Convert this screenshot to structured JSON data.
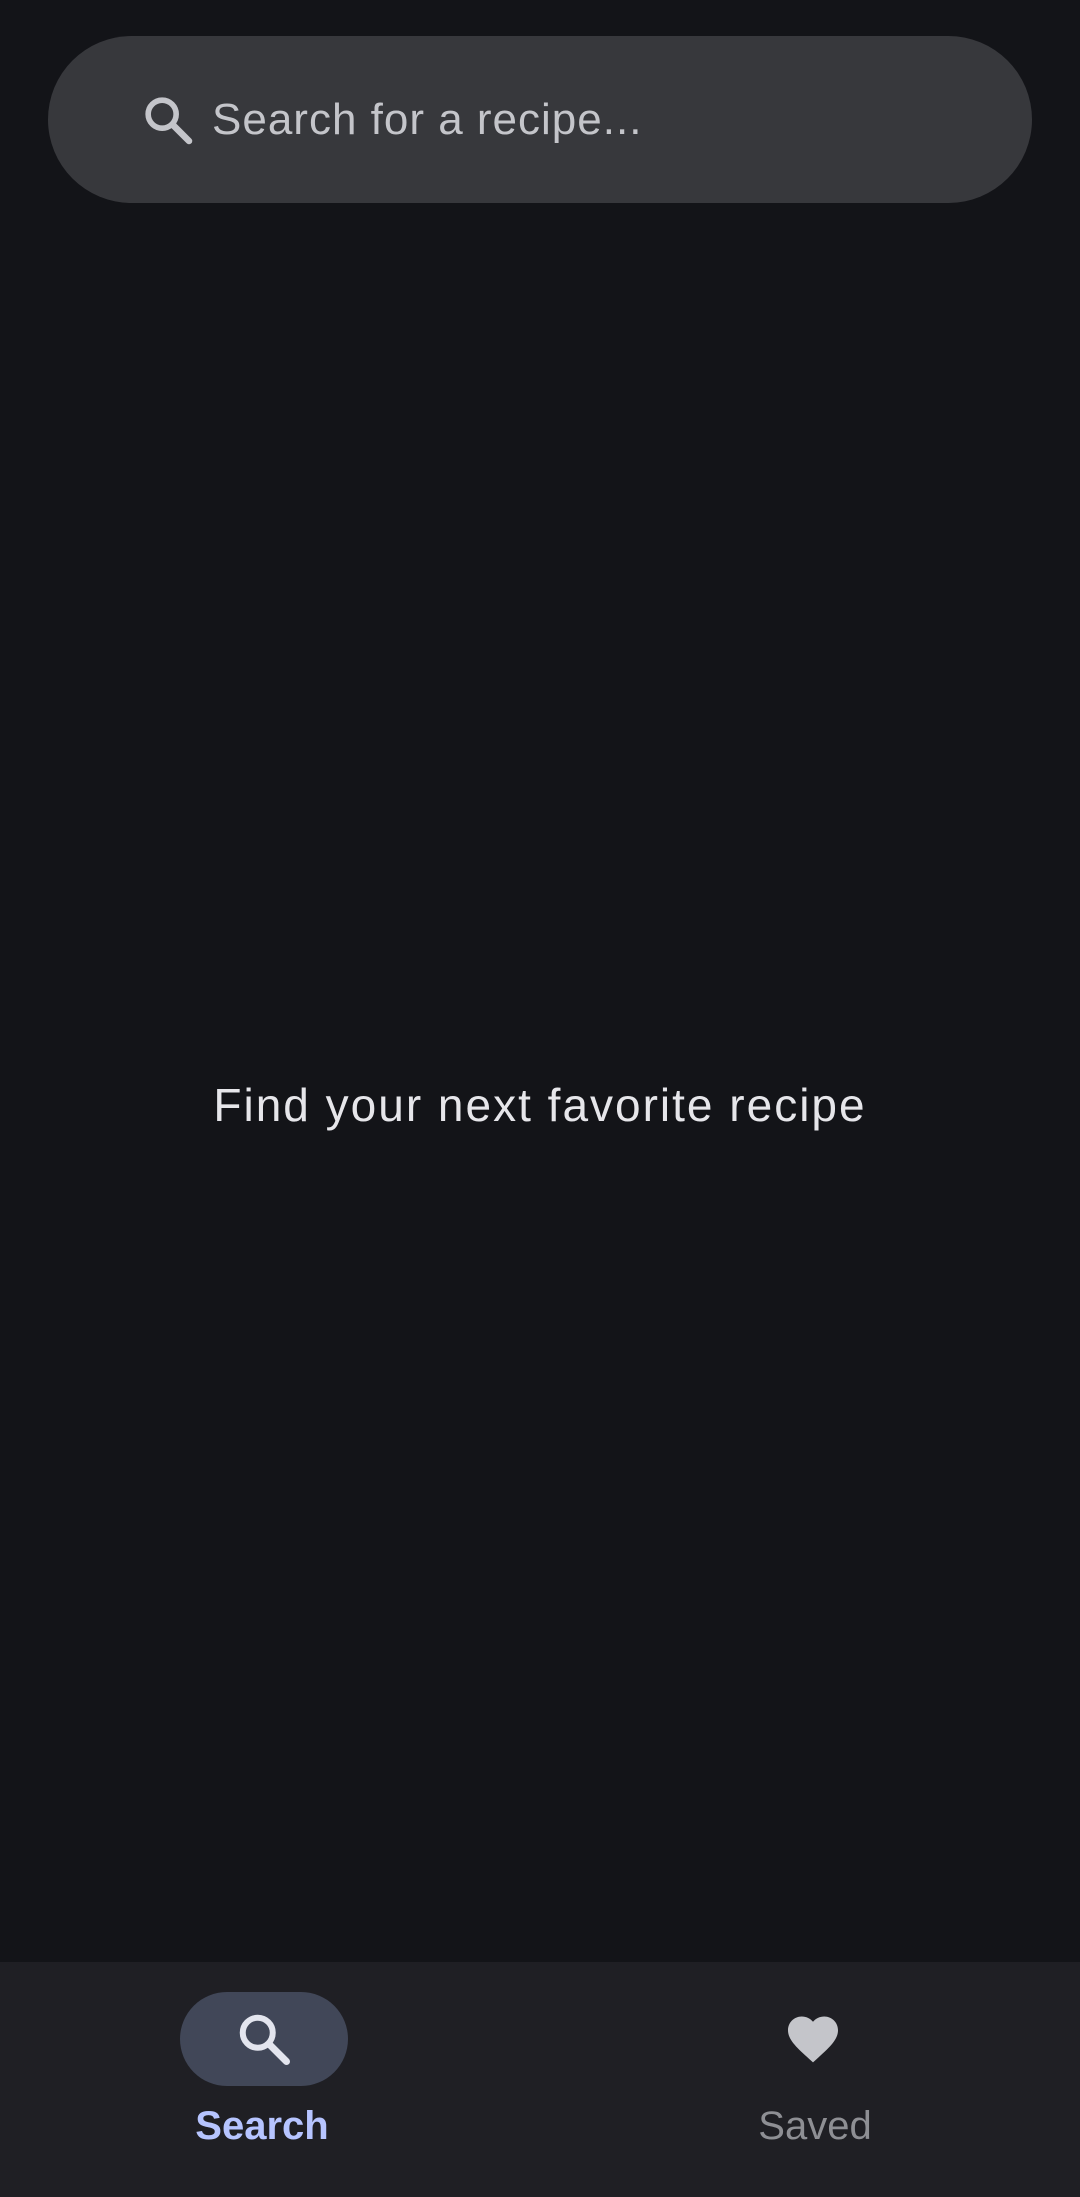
{
  "search": {
    "placeholder": "Search for a recipe...",
    "value": ""
  },
  "main": {
    "empty_message": "Find your next favorite recipe"
  },
  "bottom_nav": {
    "items": [
      {
        "label": "Search",
        "icon": "search-icon",
        "active": true
      },
      {
        "label": "Saved",
        "icon": "heart-icon",
        "active": false
      }
    ]
  },
  "colors": {
    "background": "#131418",
    "search_bar": "#37383c",
    "nav_background": "#1f1f24",
    "active_pill": "#414758",
    "active_label": "#b6c4ff",
    "inactive_label": "#8e8f94",
    "icon": "#c4c5ca"
  }
}
